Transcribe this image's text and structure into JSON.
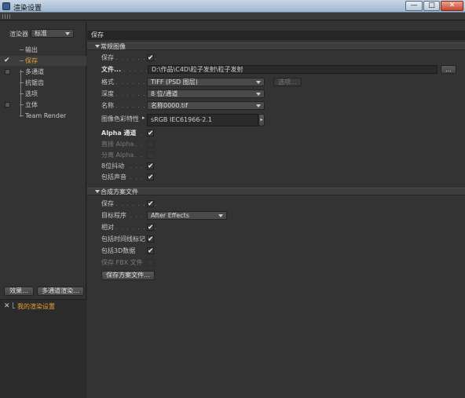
{
  "window": {
    "title": "渲染设置",
    "min": "—",
    "max": "□",
    "close": "✕"
  },
  "left": {
    "renderer_label": "渲染器",
    "renderer_value": "标准",
    "tree": [
      {
        "label": "输出",
        "checked": false,
        "box": false,
        "selected": false
      },
      {
        "label": "保存",
        "checked": true,
        "box": false,
        "selected": true
      },
      {
        "label": "多通道",
        "checked": false,
        "box": true,
        "selected": false
      },
      {
        "label": "抗锯齿",
        "checked": false,
        "box": false,
        "selected": false
      },
      {
        "label": "选项",
        "checked": false,
        "box": false,
        "selected": false
      },
      {
        "label": "立体",
        "checked": false,
        "box": true,
        "selected": false
      },
      {
        "label": "Team Render",
        "checked": false,
        "box": false,
        "selected": false
      }
    ],
    "effects_button": "效果...",
    "multipass_button": "多通道渲染...",
    "my_settings": "我的渲染设置"
  },
  "right": {
    "header": "保存",
    "section1": {
      "title": "常规图像",
      "save_label": "保存",
      "save_checked": true,
      "file_label": "文件...",
      "file_value": "D:\\作品\\C4D\\粒子发射\\粒子发射",
      "browse": "...",
      "format_label": "格式",
      "format_value": "TIFF (PSD 图层)",
      "options_button": "选项...",
      "depth_label": "深度",
      "depth_value": "8 位/通道",
      "name_label": "名称",
      "name_value": "名称0000.tif",
      "profile_label": "图像色彩特性",
      "profile_value": "sRGB IEC61966-2.1",
      "alpha_label": "Alpha 通道",
      "alpha_checked": true,
      "straight_label": "直接 Alpha",
      "straight_checked": false,
      "separate_label": "分离 Alpha",
      "separate_checked": false,
      "dither_label": "8位抖动",
      "dither_checked": true,
      "sound_label": "包括声音",
      "sound_checked": true
    },
    "section2": {
      "title": "合成方案文件",
      "save_label": "保存",
      "save_checked": true,
      "target_label": "目标程序",
      "target_value": "After Effects",
      "relative_label": "相对",
      "relative_checked": true,
      "timeline_label": "包括时间线标记",
      "timeline_checked": true,
      "data3d_label": "包括3D数据",
      "data3d_checked": true,
      "fbx_label": "保存 FBX 文件",
      "fbx_checked": false,
      "save_project_button": "保存方案文件..."
    }
  }
}
